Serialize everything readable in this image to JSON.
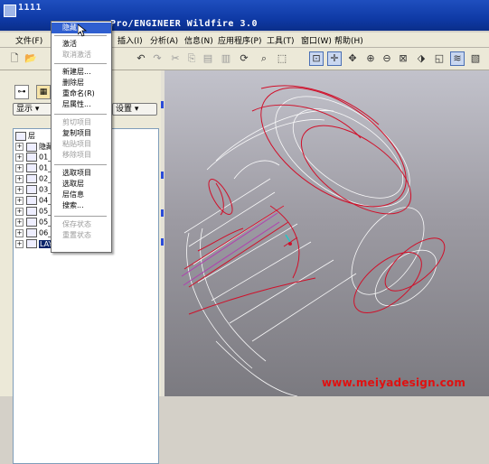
{
  "window": {
    "title_left": "1111",
    "title_right": "Pro/ENGINEER Wildfire 3.0"
  },
  "menubar": {
    "items": [
      "文件(F)",
      "插入(I)",
      "分析(A)",
      "信息(N)",
      "应用程序(P)",
      "工具(T)",
      "窗口(W)",
      "帮助(H)"
    ]
  },
  "left_panel": {
    "show_button": "显示",
    "settings_button": "设置",
    "tree_root_label": "层",
    "tree_items": [
      {
        "label": "隐藏",
        "prefix": "隐藏"
      },
      {
        "label": "01_",
        "suffix": "N"
      },
      {
        "label": "01_",
        "suffix": "N"
      },
      {
        "label": "02_",
        "suffix": ""
      },
      {
        "label": "03_",
        "suffix": ""
      },
      {
        "label": "04_",
        "suffix": "T"
      },
      {
        "label": "05_",
        "suffix": "YS"
      },
      {
        "label": "05_",
        "suffix": "YS"
      },
      {
        "label": "06_",
        "suffix": ""
      },
      {
        "label": "LAY",
        "selected": true
      }
    ]
  },
  "context_menu": {
    "items": [
      {
        "label": "隐藏",
        "state": "highlighted"
      },
      {
        "sep": true
      },
      {
        "label": "激活",
        "state": "enabled"
      },
      {
        "label": "取消激活",
        "state": "disabled"
      },
      {
        "sep": true
      },
      {
        "label": "新建层...",
        "state": "enabled"
      },
      {
        "label": "删除层",
        "state": "enabled"
      },
      {
        "label": "重命名(R)",
        "state": "enabled"
      },
      {
        "label": "层属性...",
        "state": "enabled"
      },
      {
        "sep": true
      },
      {
        "label": "剪切项目",
        "state": "disabled"
      },
      {
        "label": "复制项目",
        "state": "enabled"
      },
      {
        "label": "粘贴项目",
        "state": "disabled"
      },
      {
        "label": "移除项目",
        "state": "disabled"
      },
      {
        "sep": true
      },
      {
        "label": "选取项目",
        "state": "enabled"
      },
      {
        "label": "选取层",
        "state": "enabled"
      },
      {
        "label": "层信息",
        "state": "enabled"
      },
      {
        "label": "搜索...",
        "state": "enabled"
      },
      {
        "sep": true
      },
      {
        "label": "保存状态",
        "state": "disabled"
      },
      {
        "label": "重置状态",
        "state": "disabled"
      }
    ]
  },
  "watermark": "www.meiyadesign.com",
  "colors": {
    "titlebar": "#0f3aa6",
    "menu_highlight": "#2f5fd0",
    "model_red": "#d0102a",
    "watermark": "#e01010"
  }
}
